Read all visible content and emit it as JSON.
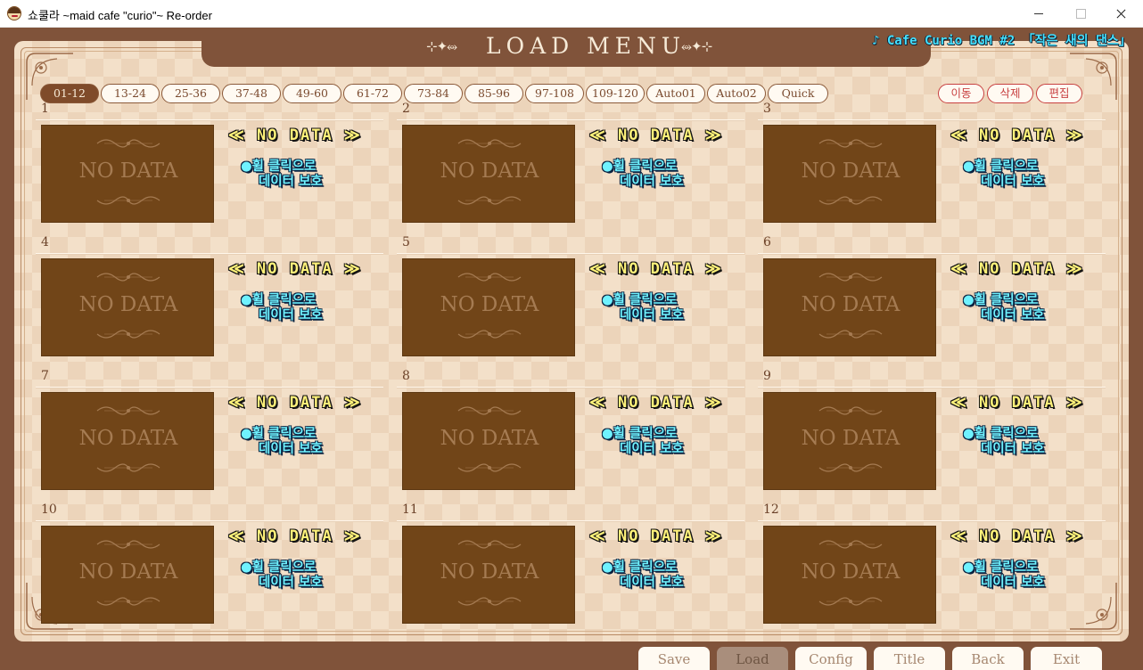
{
  "window": {
    "title": "쇼쿨라 ~maid cafe \"curio\"~ Re-order"
  },
  "header": {
    "title": "LOAD MENU",
    "ornament_left": "⊹✦⥈",
    "ornament_right": "⥈✦⊹",
    "bgm": "♪ Cafe Curio BGM #2 「작은 새의 댄스」"
  },
  "tabs": [
    {
      "label": "01-12",
      "active": true
    },
    {
      "label": "13-24",
      "active": false
    },
    {
      "label": "25-36",
      "active": false
    },
    {
      "label": "37-48",
      "active": false
    },
    {
      "label": "49-60",
      "active": false
    },
    {
      "label": "61-72",
      "active": false
    },
    {
      "label": "73-84",
      "active": false
    },
    {
      "label": "85-96",
      "active": false
    },
    {
      "label": "97-108",
      "active": false
    },
    {
      "label": "109-120",
      "active": false
    },
    {
      "label": "Auto01",
      "active": false
    },
    {
      "label": "Auto02",
      "active": false
    },
    {
      "label": "Quick",
      "active": false
    }
  ],
  "actions": {
    "move": "이동",
    "delete": "삭제",
    "edit": "편집"
  },
  "slots": [
    {
      "number": "1",
      "thumb_text": "NO DATA",
      "status": "≪ NO DATA ≫",
      "protect_line1": "●휠 클릭으로",
      "protect_line2": "데이터 보호"
    },
    {
      "number": "2",
      "thumb_text": "NO DATA",
      "status": "≪ NO DATA ≫",
      "protect_line1": "●휠 클릭으로",
      "protect_line2": "데이터 보호"
    },
    {
      "number": "3",
      "thumb_text": "NO DATA",
      "status": "≪ NO DATA ≫",
      "protect_line1": "●휠 클릭으로",
      "protect_line2": "데이터 보호"
    },
    {
      "number": "4",
      "thumb_text": "NO DATA",
      "status": "≪ NO DATA ≫",
      "protect_line1": "●휠 클릭으로",
      "protect_line2": "데이터 보호"
    },
    {
      "number": "5",
      "thumb_text": "NO DATA",
      "status": "≪ NO DATA ≫",
      "protect_line1": "●휠 클릭으로",
      "protect_line2": "데이터 보호"
    },
    {
      "number": "6",
      "thumb_text": "NO DATA",
      "status": "≪ NO DATA ≫",
      "protect_line1": "●휠 클릭으로",
      "protect_line2": "데이터 보호"
    },
    {
      "number": "7",
      "thumb_text": "NO DATA",
      "status": "≪ NO DATA ≫",
      "protect_line1": "●휠 클릭으로",
      "protect_line2": "데이터 보호"
    },
    {
      "number": "8",
      "thumb_text": "NO DATA",
      "status": "≪ NO DATA ≫",
      "protect_line1": "●휠 클릭으로",
      "protect_line2": "데이터 보호"
    },
    {
      "number": "9",
      "thumb_text": "NO DATA",
      "status": "≪ NO DATA ≫",
      "protect_line1": "●휠 클릭으로",
      "protect_line2": "데이터 보호"
    },
    {
      "number": "10",
      "thumb_text": "NO DATA",
      "status": "≪ NO DATA ≫",
      "protect_line1": "●휠 클릭으로",
      "protect_line2": "데이터 보호"
    },
    {
      "number": "11",
      "thumb_text": "NO DATA",
      "status": "≪ NO DATA ≫",
      "protect_line1": "●휠 클릭으로",
      "protect_line2": "데이터 보호"
    },
    {
      "number": "12",
      "thumb_text": "NO DATA",
      "status": "≪ NO DATA ≫",
      "protect_line1": "●휠 클릭으로",
      "protect_line2": "데이터 보호"
    }
  ],
  "bottom_nav": {
    "save": "Save",
    "load": "Load",
    "config": "Config",
    "title": "Title",
    "back": "Back",
    "exit": "Exit"
  },
  "colors": {
    "frame_brown": "#80533a",
    "panel_cream": "#f3e0c9",
    "thumb_brown": "#714518",
    "active_tab": "#7f4b2a",
    "action_red": "#c84141",
    "nodata_yellow": "#fff27a",
    "protect_cyan": "#6ff2ff",
    "bgm_cyan": "#44e0ff"
  }
}
